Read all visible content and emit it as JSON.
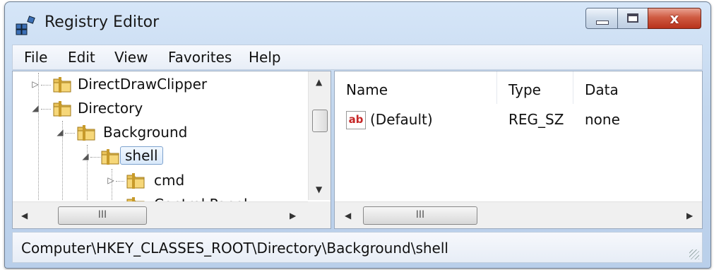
{
  "window": {
    "title": "Registry Editor",
    "close_glyph": "x"
  },
  "menu": [
    "File",
    "Edit",
    "View",
    "Favorites",
    "Help"
  ],
  "tree": [
    {
      "label": "DirectDrawClipper",
      "expander": "▷"
    },
    {
      "label": "Directory",
      "expander": "◢"
    },
    {
      "label": "Background",
      "expander": "◢"
    },
    {
      "label": "shell",
      "expander": "◢",
      "selected": true
    },
    {
      "label": "cmd",
      "expander": "▷"
    },
    {
      "label": "Control Panel",
      "expander": ""
    }
  ],
  "list": {
    "columns": [
      "Name",
      "Type",
      "Data"
    ],
    "rows": [
      {
        "icon": "ab",
        "name": "(Default)",
        "type": "REG_SZ",
        "data": "none"
      }
    ]
  },
  "scroll": {
    "thumb_glyph": "III",
    "left": "◀",
    "right": "▶",
    "up": "▲",
    "down": "▼"
  },
  "status": {
    "path": "Computer\\HKEY_CLASSES_ROOT\\Directory\\Background\\shell"
  },
  "colors": {
    "accent": "#c3d7ee",
    "selection": "#d8e8fa",
    "close": "#cf5b42"
  },
  "icons": [
    "registry-editor-app-icon",
    "folder-icon",
    "string-value-icon",
    "resize-grip-icon"
  ]
}
